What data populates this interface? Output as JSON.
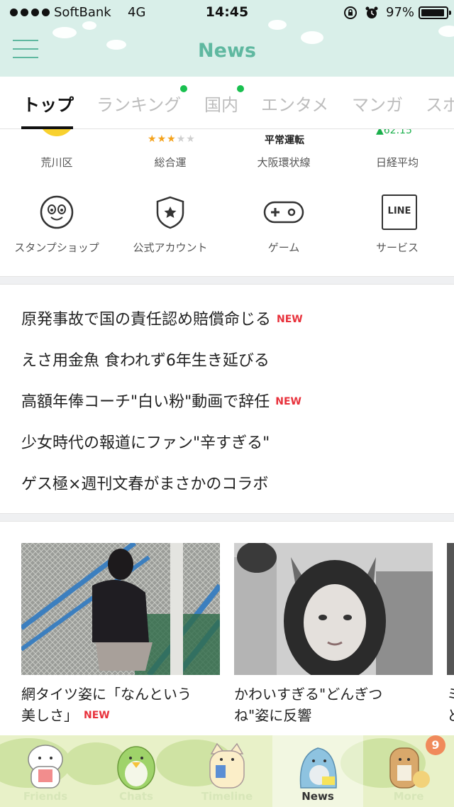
{
  "status_bar": {
    "carrier": "SoftBank",
    "network": "4G",
    "time": "14:45",
    "battery_percent": "97%",
    "battery_level": 0.97
  },
  "header": {
    "title": "News"
  },
  "tabs": [
    {
      "label": "トップ",
      "active": true,
      "dot": false
    },
    {
      "label": "ランキング",
      "active": false,
      "dot": true
    },
    {
      "label": "国内",
      "active": false,
      "dot": true
    },
    {
      "label": "エンタメ",
      "active": false,
      "dot": false
    },
    {
      "label": "マンガ",
      "active": false,
      "dot": false
    },
    {
      "label": "スポ",
      "active": false,
      "dot": false
    }
  ],
  "widgets": {
    "weather": {
      "label": "荒川区",
      "icon": "sun-icon"
    },
    "fortune": {
      "label": "総合運",
      "stars": 3,
      "max_stars": 5
    },
    "train": {
      "status": "平常運転",
      "label": "大阪環状線"
    },
    "stock": {
      "change": "▲62.15",
      "label": "日経平均"
    }
  },
  "services": [
    {
      "label": "スタンプショップ",
      "icon": "sticker-face-icon"
    },
    {
      "label": "公式アカウント",
      "icon": "shield-star-icon"
    },
    {
      "label": "ゲーム",
      "icon": "gamepad-icon"
    },
    {
      "label": "サービス",
      "icon": "line-logo-icon",
      "icon_text": "LINE"
    }
  ],
  "headlines": [
    {
      "text": "原発事故で国の責任認め賠償命じる",
      "new": "NEW"
    },
    {
      "text": "えさ用金魚 食われず6年生き延びる",
      "new": ""
    },
    {
      "text": "高額年俸コーチ\"白い粉\"動画で辞任",
      "new": "NEW"
    },
    {
      "text": "少女時代の報道にファン\"辛すぎる\"",
      "new": ""
    },
    {
      "text": "ゲス極×週刊文春がまさかのコラボ",
      "new": ""
    }
  ],
  "cards": [
    {
      "title_line1": "網タイツ姿に「なんという",
      "title_line2": "美しさ」",
      "new": "NEW"
    },
    {
      "title_line1": "かわいすぎる\"どんぎつ",
      "title_line2": "ね\"姿に反響",
      "new": ""
    },
    {
      "title_line1": "ミ",
      "title_line2": "と",
      "new": ""
    }
  ],
  "tabbar": [
    {
      "label": "Friends",
      "active": false
    },
    {
      "label": "Chats",
      "active": false
    },
    {
      "label": "Timeline",
      "active": false
    },
    {
      "label": "News",
      "active": true
    },
    {
      "label": "More",
      "active": false,
      "badge": "9"
    }
  ],
  "colors": {
    "accent": "#5fb8a0",
    "header_bg": "#d9efe9",
    "new_badge": "#e8323c",
    "tab_dot": "#19c04f",
    "stock_up": "#1aaf4b"
  }
}
